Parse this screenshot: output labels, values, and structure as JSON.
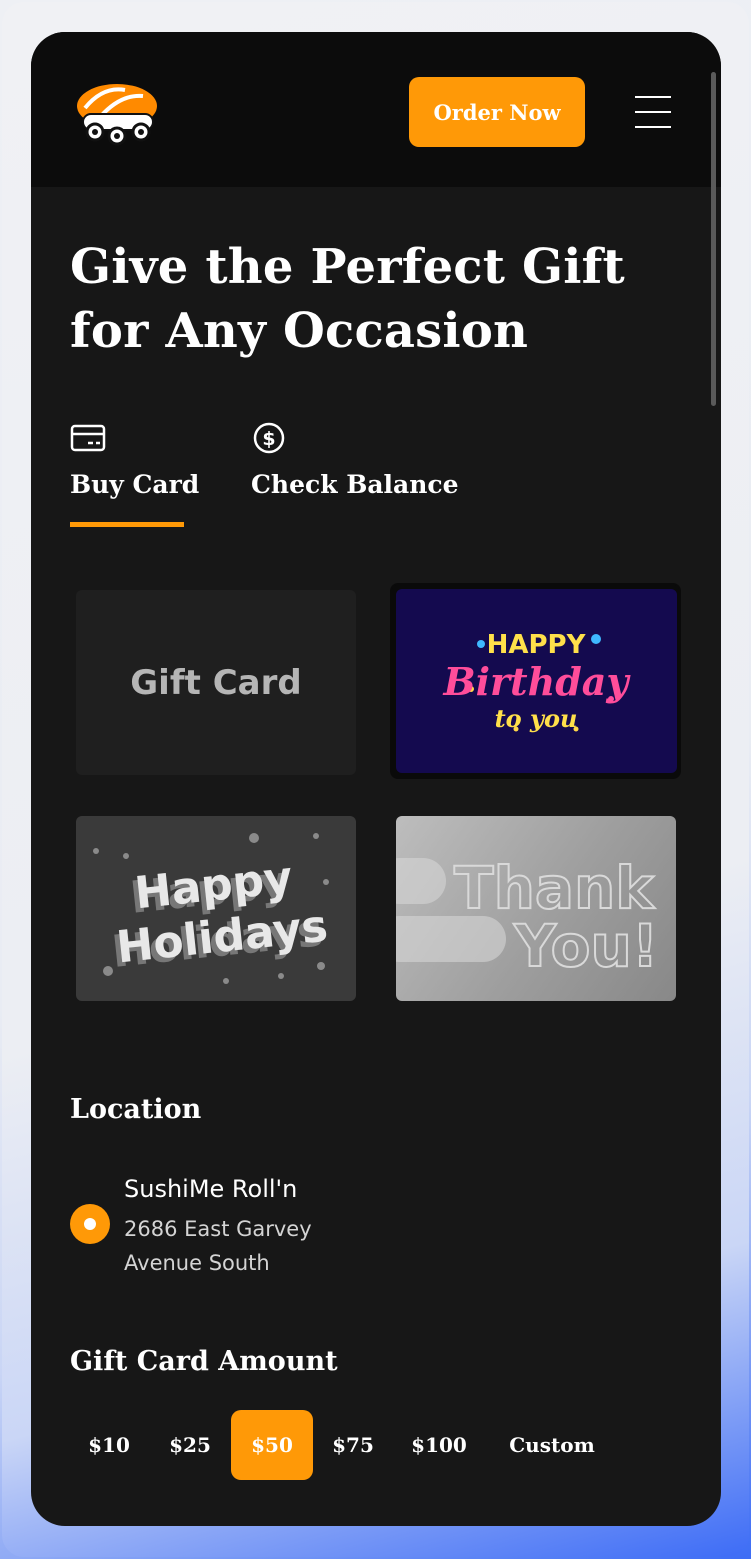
{
  "header": {
    "order_button": "Order Now"
  },
  "hero": {
    "title": "Give the Perfect Gift for Any Occasion"
  },
  "tabs": [
    {
      "label": "Buy Card",
      "icon": "credit-card-icon",
      "active": true
    },
    {
      "label": "Check Balance",
      "icon": "dollar-circle-icon",
      "active": false
    }
  ],
  "cards": {
    "gift": {
      "label": "Gift Card"
    },
    "birthday": {
      "line1": "HAPPY",
      "line2": "Birthday",
      "line3": "to you"
    },
    "holidays": {
      "line1": "Happy",
      "line2": "Holidays"
    },
    "thanks": {
      "line1": "Thank",
      "line2": "You!"
    }
  },
  "location": {
    "title": "Location",
    "name": "SushiMe Roll'n",
    "address": "2686 East Garvey Avenue South"
  },
  "amount": {
    "title": "Gift Card Amount",
    "options": [
      "$10",
      "$25",
      "$50",
      "$75",
      "$100",
      "Custom"
    ],
    "selected": "$50"
  },
  "colors": {
    "accent": "#ff9907",
    "background": "#171717",
    "header": "#0c0c0c"
  }
}
